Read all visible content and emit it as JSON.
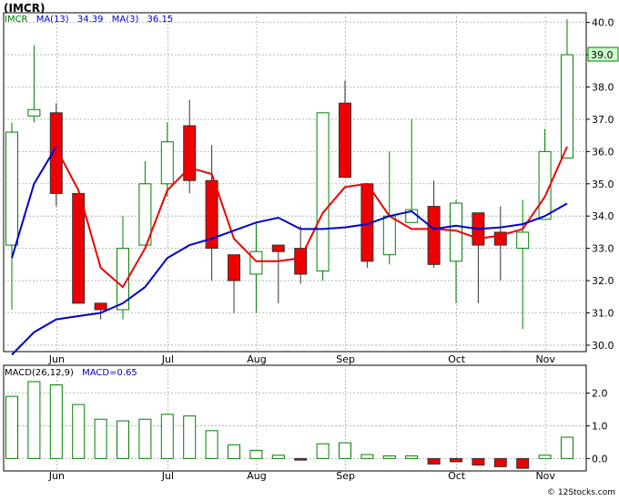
{
  "title": "(IMCR)",
  "footer": "© 12Stocks.com",
  "colors": {
    "up_candle": "#008000",
    "down_candle": "#ee0000",
    "ma13": "#0000cc",
    "ma3": "#ee0000",
    "macd_up": "#008000",
    "macd_down": "#ee0000",
    "grid": "#aaaaaa",
    "last_price_bg": "#ccffcc",
    "legend_name": "#007700",
    "legend_text": "#0000cc"
  },
  "price_panel": {
    "legend": {
      "symbol": "IMCR",
      "ma13_label": "MA(13)",
      "ma13_value": "34.39",
      "ma3_label": "MA(3)",
      "ma3_value": "36.15"
    },
    "last_price_label": "39.0"
  },
  "macd_panel": {
    "legend": {
      "label": "MACD(26,12,9)",
      "value_label": "MACD=0.65"
    }
  },
  "chart_data": [
    {
      "type": "candlestick",
      "x_labels": [
        "Jun",
        "Jul",
        "Aug",
        "Sep",
        "Oct",
        "Nov"
      ],
      "x_label_positions": [
        1,
        6,
        10,
        14,
        19,
        23
      ],
      "y_ticks": [
        "30.0",
        "31.0",
        "32.0",
        "33.0",
        "34.0",
        "35.0",
        "36.0",
        "37.0",
        "38.0",
        "39.0",
        "40.0"
      ],
      "ylim": [
        29.8,
        40.3
      ],
      "candles": [
        {
          "o": 33.1,
          "h": 36.9,
          "l": 31.1,
          "c": 36.6
        },
        {
          "o": 37.1,
          "h": 39.3,
          "l": 36.9,
          "c": 37.3
        },
        {
          "o": 37.2,
          "h": 37.5,
          "l": 34.3,
          "c": 34.7
        },
        {
          "o": 34.7,
          "h": 34.7,
          "l": 31.3,
          "c": 31.3
        },
        {
          "o": 31.3,
          "h": 31.3,
          "l": 30.8,
          "c": 31.1
        },
        {
          "o": 31.1,
          "h": 34.0,
          "l": 30.8,
          "c": 33.0
        },
        {
          "o": 33.1,
          "h": 35.7,
          "l": 33.1,
          "c": 35.0
        },
        {
          "o": 35.0,
          "h": 36.9,
          "l": 34.6,
          "c": 36.3
        },
        {
          "o": 36.8,
          "h": 37.6,
          "l": 34.7,
          "c": 35.1
        },
        {
          "o": 35.1,
          "h": 36.2,
          "l": 32.0,
          "c": 33.0
        },
        {
          "o": 32.8,
          "h": 32.8,
          "l": 31.0,
          "c": 32.0
        },
        {
          "o": 32.2,
          "h": 33.8,
          "l": 31.0,
          "c": 32.9
        },
        {
          "o": 33.1,
          "h": 33.1,
          "l": 31.3,
          "c": 32.9
        },
        {
          "o": 33.0,
          "h": 33.7,
          "l": 31.9,
          "c": 32.2
        },
        {
          "o": 32.3,
          "h": 37.2,
          "l": 32.0,
          "c": 37.2
        },
        {
          "o": 37.5,
          "h": 38.2,
          "l": 35.2,
          "c": 35.2
        },
        {
          "o": 35.0,
          "h": 35.0,
          "l": 32.4,
          "c": 32.6
        },
        {
          "o": 32.8,
          "h": 36.0,
          "l": 32.5,
          "c": 34.0
        },
        {
          "o": 33.8,
          "h": 37.0,
          "l": 33.8,
          "c": 34.2
        },
        {
          "o": 34.3,
          "h": 35.1,
          "l": 32.4,
          "c": 32.5
        },
        {
          "o": 32.6,
          "h": 34.5,
          "l": 31.3,
          "c": 34.4
        },
        {
          "o": 34.1,
          "h": 34.1,
          "l": 31.3,
          "c": 33.1
        },
        {
          "o": 33.5,
          "h": 34.3,
          "l": 32.0,
          "c": 33.1
        },
        {
          "o": 33.0,
          "h": 34.5,
          "l": 30.5,
          "c": 33.5
        },
        {
          "o": 33.9,
          "h": 36.7,
          "l": 33.9,
          "c": 36.0
        },
        {
          "o": 35.8,
          "h": 40.1,
          "l": 35.8,
          "c": 39.0
        }
      ],
      "ma13": [
        {
          "i": 0,
          "v": 29.7
        },
        {
          "i": 1,
          "v": 30.4
        },
        {
          "i": 2,
          "v": 30.8
        },
        {
          "i": 3,
          "v": 30.9
        },
        {
          "i": 4,
          "v": 31.0
        },
        {
          "i": 5,
          "v": 31.3
        },
        {
          "i": 6,
          "v": 31.8
        },
        {
          "i": 7,
          "v": 32.7
        },
        {
          "i": 8,
          "v": 33.1
        },
        {
          "i": 9,
          "v": 33.3
        },
        {
          "i": 10,
          "v": 33.55
        },
        {
          "i": 11,
          "v": 33.8
        },
        {
          "i": 12,
          "v": 33.95
        },
        {
          "i": 13,
          "v": 33.6
        },
        {
          "i": 14,
          "v": 33.6
        },
        {
          "i": 15,
          "v": 33.65
        },
        {
          "i": 16,
          "v": 33.75
        },
        {
          "i": 17,
          "v": 34.0
        },
        {
          "i": 18,
          "v": 34.15
        },
        {
          "i": 19,
          "v": 33.6
        },
        {
          "i": 20,
          "v": 33.7
        },
        {
          "i": 21,
          "v": 33.6
        },
        {
          "i": 22,
          "v": 33.65
        },
        {
          "i": 23,
          "v": 33.75
        },
        {
          "i": 24,
          "v": 34.0
        },
        {
          "i": 25,
          "v": 34.39
        }
      ],
      "ma13_short": [
        {
          "i": 0,
          "v": 32.7
        },
        {
          "i": 1,
          "v": 35.0
        },
        {
          "i": 2,
          "v": 36.15
        }
      ],
      "ma3": [
        {
          "i": 2,
          "v": 36.1
        },
        {
          "i": 3,
          "v": 34.8
        },
        {
          "i": 4,
          "v": 32.4
        },
        {
          "i": 5,
          "v": 31.8
        },
        {
          "i": 6,
          "v": 33.0
        },
        {
          "i": 7,
          "v": 34.8
        },
        {
          "i": 8,
          "v": 35.5
        },
        {
          "i": 9,
          "v": 35.3
        },
        {
          "i": 10,
          "v": 33.3
        },
        {
          "i": 11,
          "v": 32.6
        },
        {
          "i": 12,
          "v": 32.6
        },
        {
          "i": 13,
          "v": 32.7
        },
        {
          "i": 14,
          "v": 34.1
        },
        {
          "i": 15,
          "v": 34.9
        },
        {
          "i": 16,
          "v": 35.0
        },
        {
          "i": 17,
          "v": 34.0
        },
        {
          "i": 18,
          "v": 33.6
        },
        {
          "i": 19,
          "v": 33.6
        },
        {
          "i": 20,
          "v": 33.55
        },
        {
          "i": 21,
          "v": 33.3
        },
        {
          "i": 22,
          "v": 33.4
        },
        {
          "i": 23,
          "v": 33.6
        },
        {
          "i": 24,
          "v": 34.6
        },
        {
          "i": 25,
          "v": 36.15
        }
      ]
    },
    {
      "type": "bar",
      "y_ticks": [
        "0.0",
        "1.0",
        "2.0"
      ],
      "ylim": [
        -0.38,
        2.85
      ],
      "values": [
        1.9,
        2.35,
        2.25,
        1.65,
        1.2,
        1.15,
        1.2,
        1.35,
        1.3,
        0.85,
        0.42,
        0.25,
        0.1,
        -0.05,
        0.45,
        0.48,
        0.12,
        0.08,
        0.08,
        -0.17,
        -0.1,
        -0.2,
        -0.25,
        -0.3,
        0.1,
        0.65
      ]
    }
  ]
}
